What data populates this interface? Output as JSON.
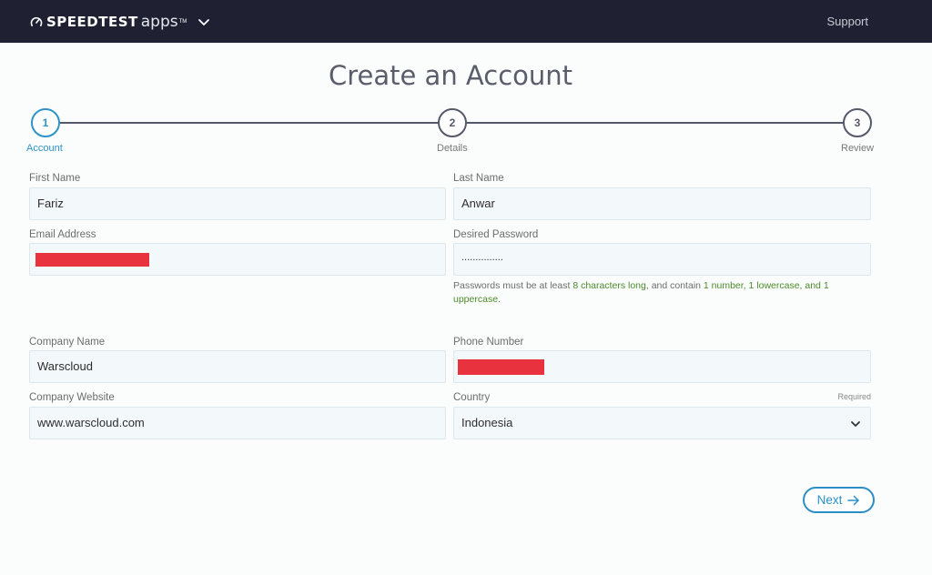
{
  "header": {
    "brand": "SPEEDTEST",
    "apps": "apps",
    "tm": "TM",
    "support_label": "Support"
  },
  "page": {
    "title": "Create an Account"
  },
  "stepper": {
    "steps": [
      {
        "number": "1",
        "label": "Account",
        "active": true
      },
      {
        "number": "2",
        "label": "Details",
        "active": false
      },
      {
        "number": "3",
        "label": "Review",
        "active": false
      }
    ]
  },
  "form": {
    "first_name": {
      "label": "First Name",
      "value": "Fariz"
    },
    "last_name": {
      "label": "Last Name",
      "value": "Anwar"
    },
    "email": {
      "label": "Email Address",
      "value": ""
    },
    "password": {
      "label": "Desired Password",
      "value": "...............",
      "hint_parts": [
        "Passwords must be at least ",
        "8 characters long",
        ", and contain ",
        "1 number, 1 lowercase, and 1 uppercase",
        "."
      ]
    },
    "company_name": {
      "label": "Company Name",
      "value": "Warscloud"
    },
    "phone": {
      "label": "Phone Number",
      "value": ""
    },
    "company_website": {
      "label": "Company Website",
      "value": "www.warscloud.com"
    },
    "country": {
      "label": "Country",
      "value": "Indonesia",
      "required_label": "Required"
    }
  },
  "actions": {
    "next_label": "Next"
  },
  "colors": {
    "topbar": "#1f2133",
    "accent": "#2a8fc7",
    "hint_green": "#4c8b2b",
    "redaction": "#e8323e"
  },
  "icons": {
    "logo": "speedometer-icon",
    "menu": "chevron-down-icon",
    "select": "chevron-down-icon",
    "next": "arrow-right-icon"
  }
}
